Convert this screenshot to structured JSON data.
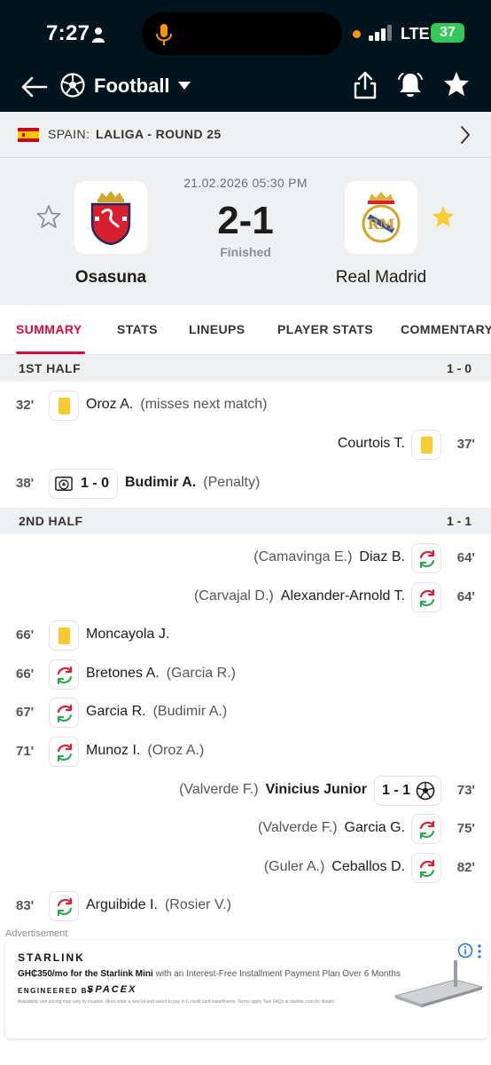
{
  "status_bar": {
    "time": "7:27",
    "network": "LTE",
    "battery": "37"
  },
  "nav": {
    "title": "Football"
  },
  "breadcrumb": {
    "country": "SPAIN:",
    "league": "LALIGA - ROUND 25"
  },
  "match": {
    "date": "21.02.2026 05:30 PM",
    "score": "2-1",
    "status": "Finished",
    "home_team": "Osasuna",
    "away_team": "Real Madrid"
  },
  "tabs": [
    "SUMMARY",
    "STATS",
    "LINEUPS",
    "PLAYER STATS",
    "COMMENTARY"
  ],
  "colors": {
    "header_bg": "#00141e",
    "accent": "#dc0a3c",
    "yellow_card": "#fccb32",
    "favorite_star": "#fccb32"
  },
  "periods": [
    {
      "name": "1ST HALF",
      "score": "1 - 0",
      "events": [
        {
          "side": "home",
          "minute": "32'",
          "type": "yellow-card",
          "player": "Oroz A.",
          "detail": "(misses next match)"
        },
        {
          "side": "away",
          "minute": "37'",
          "type": "yellow-card",
          "player": "Courtois T.",
          "detail": ""
        },
        {
          "side": "home",
          "minute": "38'",
          "type": "goal",
          "score": "1 - 0",
          "player": "Budimir A.",
          "detail": "(Penalty)"
        }
      ]
    },
    {
      "name": "2ND HALF",
      "score": "1 - 1",
      "events": [
        {
          "side": "away",
          "minute": "64'",
          "type": "substitution",
          "player": "Diaz B.",
          "detail": "(Camavinga E.)"
        },
        {
          "side": "away",
          "minute": "64'",
          "type": "substitution",
          "player": "Alexander-Arnold T.",
          "detail": "(Carvajal D.)"
        },
        {
          "side": "home",
          "minute": "66'",
          "type": "yellow-card",
          "player": "Moncayola J.",
          "detail": ""
        },
        {
          "side": "home",
          "minute": "66'",
          "type": "substitution",
          "player": "Bretones A.",
          "detail": "(Garcia R.)"
        },
        {
          "side": "home",
          "minute": "67'",
          "type": "substitution",
          "player": "Garcia R.",
          "detail": "(Budimir A.)"
        },
        {
          "side": "home",
          "minute": "71'",
          "type": "substitution",
          "player": "Munoz I.",
          "detail": "(Oroz A.)"
        },
        {
          "side": "away",
          "minute": "73'",
          "type": "goal",
          "score": "1 - 1",
          "player": "Vinicius Junior",
          "detail": "(Valverde F.)"
        },
        {
          "side": "away",
          "minute": "75'",
          "type": "substitution",
          "player": "Garcia G.",
          "detail": "(Valverde F.)"
        },
        {
          "side": "away",
          "minute": "82'",
          "type": "substitution",
          "player": "Ceballos D.",
          "detail": "(Guler A.)"
        },
        {
          "side": "home",
          "minute": "83'",
          "type": "substitution",
          "player": "Arguibide I.",
          "detail": "(Rosier V.)"
        }
      ]
    }
  ],
  "ad": {
    "label": "Advertisement",
    "brand": "STARLINK",
    "price": "GH₵350/mo for the Starlink Mini",
    "line": "with an Interest-Free Installment Payment Plan Over 6 Months",
    "engineered": "ENGINEERED BY",
    "maker": "SPACEX",
    "fine_print": "Availability and pricing may vary by location. Must order a new kit and select to pay in 6 credit card installments. Terms apply. See FAQs at starlink.com for details."
  }
}
